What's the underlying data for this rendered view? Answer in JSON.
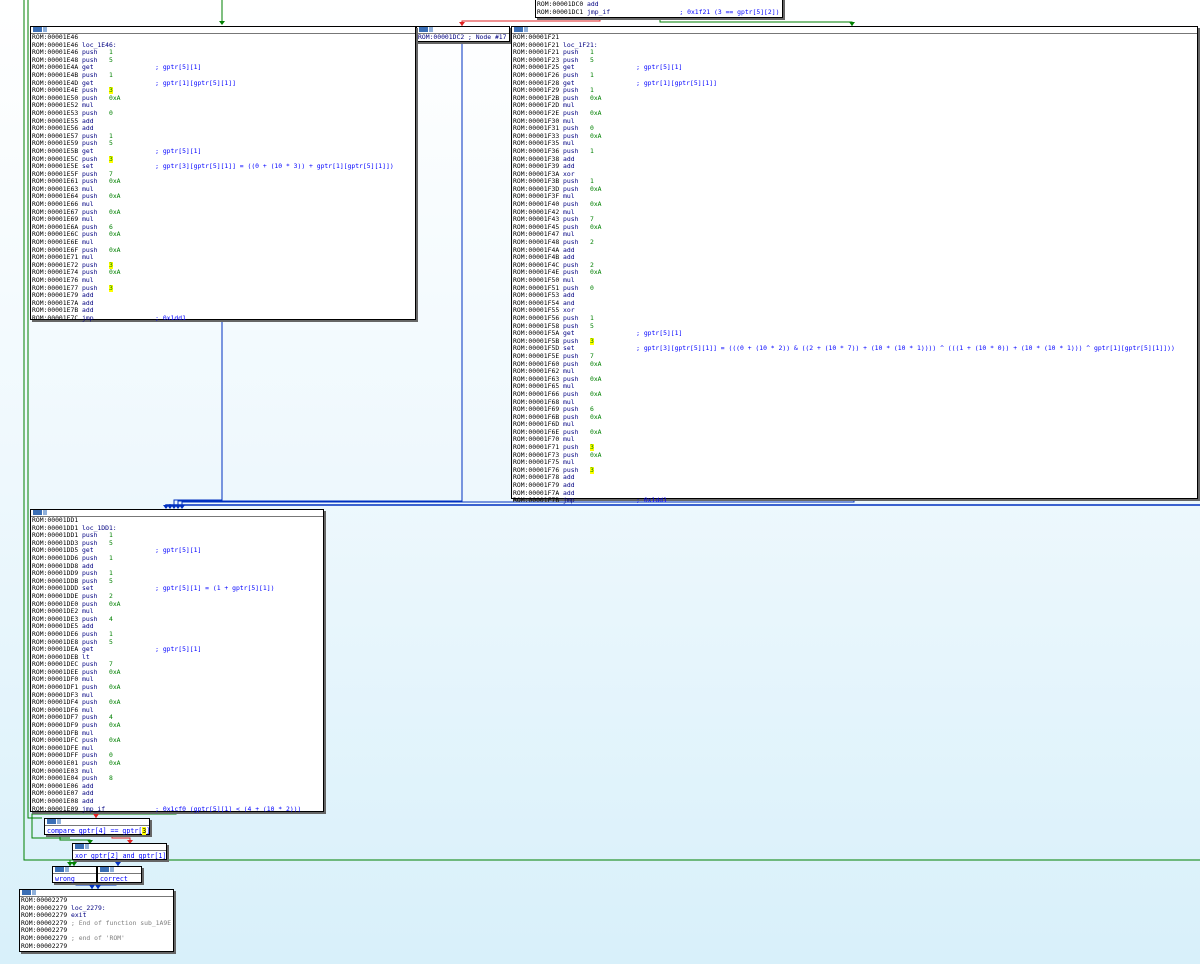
{
  "app": {
    "view": "IDA graph view"
  },
  "colors": {
    "edge_green": "#008000",
    "edge_red": "#e02020",
    "edge_blue": "#0030c0"
  },
  "top_node": {
    "lines": [
      {
        "addr": "ROM:00001DC0",
        "mnem": "add",
        "op": "",
        "cmt": ""
      },
      {
        "addr": "ROM:00001DC1",
        "mnem": "jmp_if",
        "op": "",
        "cmt": "; 0x1f21 (3 == gptr[5][2])"
      }
    ]
  },
  "node_17": {
    "text": "ROM:00001DC2 ; Node #17"
  },
  "node_1e46": {
    "lines": [
      {
        "addr": "ROM:00001E46",
        "mnem": "",
        "op": "",
        "cmt": ""
      },
      {
        "addr": "ROM:00001E46",
        "label": "loc_1E46:"
      },
      {
        "addr": "ROM:00001E46",
        "mnem": "push",
        "op": "1",
        "cmt": ""
      },
      {
        "addr": "ROM:00001E48",
        "mnem": "push",
        "op": "5",
        "cmt": ""
      },
      {
        "addr": "ROM:00001E4A",
        "mnem": "get",
        "op": "",
        "cmt": "; gptr[5][1]"
      },
      {
        "addr": "ROM:00001E4B",
        "mnem": "push",
        "op": "1",
        "cmt": ""
      },
      {
        "addr": "ROM:00001E4D",
        "mnem": "get",
        "op": "",
        "cmt": "; gptr[1][gptr[5][1]]"
      },
      {
        "addr": "ROM:00001E4E",
        "mnem": "push",
        "op": "3",
        "hl": true,
        "cmt": ""
      },
      {
        "addr": "ROM:00001E50",
        "mnem": "push",
        "op": "0xA",
        "cmt": ""
      },
      {
        "addr": "ROM:00001E52",
        "mnem": "mul",
        "op": "",
        "cmt": ""
      },
      {
        "addr": "ROM:00001E53",
        "mnem": "push",
        "op": "0",
        "cmt": ""
      },
      {
        "addr": "ROM:00001E55",
        "mnem": "add",
        "op": "",
        "cmt": ""
      },
      {
        "addr": "ROM:00001E56",
        "mnem": "add",
        "op": "",
        "cmt": ""
      },
      {
        "addr": "ROM:00001E57",
        "mnem": "push",
        "op": "1",
        "cmt": ""
      },
      {
        "addr": "ROM:00001E59",
        "mnem": "push",
        "op": "5",
        "cmt": ""
      },
      {
        "addr": "ROM:00001E5B",
        "mnem": "get",
        "op": "",
        "cmt": "; gptr[5][1]"
      },
      {
        "addr": "ROM:00001E5C",
        "mnem": "push",
        "op": "3",
        "hl": true,
        "cmt": ""
      },
      {
        "addr": "ROM:00001E5E",
        "mnem": "set",
        "op": "",
        "cmt": "; gptr[3][gptr[5][1]] = ((0 + (10 * 3)) + gptr[1][gptr[5][1]])"
      },
      {
        "addr": "ROM:00001E5F",
        "mnem": "push",
        "op": "7",
        "cmt": ""
      },
      {
        "addr": "ROM:00001E61",
        "mnem": "push",
        "op": "0xA",
        "cmt": ""
      },
      {
        "addr": "ROM:00001E63",
        "mnem": "mul",
        "op": "",
        "cmt": ""
      },
      {
        "addr": "ROM:00001E64",
        "mnem": "push",
        "op": "0xA",
        "cmt": ""
      },
      {
        "addr": "ROM:00001E66",
        "mnem": "mul",
        "op": "",
        "cmt": ""
      },
      {
        "addr": "ROM:00001E67",
        "mnem": "push",
        "op": "0xA",
        "cmt": ""
      },
      {
        "addr": "ROM:00001E69",
        "mnem": "mul",
        "op": "",
        "cmt": ""
      },
      {
        "addr": "ROM:00001E6A",
        "mnem": "push",
        "op": "6",
        "cmt": ""
      },
      {
        "addr": "ROM:00001E6C",
        "mnem": "push",
        "op": "0xA",
        "cmt": ""
      },
      {
        "addr": "ROM:00001E6E",
        "mnem": "mul",
        "op": "",
        "cmt": ""
      },
      {
        "addr": "ROM:00001E6F",
        "mnem": "push",
        "op": "0xA",
        "cmt": ""
      },
      {
        "addr": "ROM:00001E71",
        "mnem": "mul",
        "op": "",
        "cmt": ""
      },
      {
        "addr": "ROM:00001E72",
        "mnem": "push",
        "op": "3",
        "hl": true,
        "cmt": ""
      },
      {
        "addr": "ROM:00001E74",
        "mnem": "push",
        "op": "0xA",
        "cmt": ""
      },
      {
        "addr": "ROM:00001E76",
        "mnem": "mul",
        "op": "",
        "cmt": ""
      },
      {
        "addr": "ROM:00001E77",
        "mnem": "push",
        "op": "3",
        "hl": true,
        "cmt": ""
      },
      {
        "addr": "ROM:00001E79",
        "mnem": "add",
        "op": "",
        "cmt": ""
      },
      {
        "addr": "ROM:00001E7A",
        "mnem": "add",
        "op": "",
        "cmt": ""
      },
      {
        "addr": "ROM:00001E7B",
        "mnem": "add",
        "op": "",
        "cmt": ""
      },
      {
        "addr": "ROM:00001E7C",
        "mnem": "jmp",
        "op": "",
        "cmt": "; 0x1dd1"
      }
    ]
  },
  "node_1f21": {
    "lines": [
      {
        "addr": "ROM:00001F21",
        "mnem": "",
        "op": "",
        "cmt": ""
      },
      {
        "addr": "ROM:00001F21",
        "label": "loc_1F21:"
      },
      {
        "addr": "ROM:00001F21",
        "mnem": "push",
        "op": "1",
        "cmt": ""
      },
      {
        "addr": "ROM:00001F23",
        "mnem": "push",
        "op": "5",
        "cmt": ""
      },
      {
        "addr": "ROM:00001F25",
        "mnem": "get",
        "op": "",
        "cmt": "; gptr[5][1]"
      },
      {
        "addr": "ROM:00001F26",
        "mnem": "push",
        "op": "1",
        "cmt": ""
      },
      {
        "addr": "ROM:00001F28",
        "mnem": "get",
        "op": "",
        "cmt": "; gptr[1][gptr[5][1]]"
      },
      {
        "addr": "ROM:00001F29",
        "mnem": "push",
        "op": "1",
        "cmt": ""
      },
      {
        "addr": "ROM:00001F2B",
        "mnem": "push",
        "op": "0xA",
        "cmt": ""
      },
      {
        "addr": "ROM:00001F2D",
        "mnem": "mul",
        "op": "",
        "cmt": ""
      },
      {
        "addr": "ROM:00001F2E",
        "mnem": "push",
        "op": "0xA",
        "cmt": ""
      },
      {
        "addr": "ROM:00001F30",
        "mnem": "mul",
        "op": "",
        "cmt": ""
      },
      {
        "addr": "ROM:00001F31",
        "mnem": "push",
        "op": "0",
        "cmt": ""
      },
      {
        "addr": "ROM:00001F33",
        "mnem": "push",
        "op": "0xA",
        "cmt": ""
      },
      {
        "addr": "ROM:00001F35",
        "mnem": "mul",
        "op": "",
        "cmt": ""
      },
      {
        "addr": "ROM:00001F36",
        "mnem": "push",
        "op": "1",
        "cmt": ""
      },
      {
        "addr": "ROM:00001F38",
        "mnem": "add",
        "op": "",
        "cmt": ""
      },
      {
        "addr": "ROM:00001F39",
        "mnem": "add",
        "op": "",
        "cmt": ""
      },
      {
        "addr": "ROM:00001F3A",
        "mnem": "xor",
        "op": "",
        "cmt": ""
      },
      {
        "addr": "ROM:00001F3B",
        "mnem": "push",
        "op": "1",
        "cmt": ""
      },
      {
        "addr": "ROM:00001F3D",
        "mnem": "push",
        "op": "0xA",
        "cmt": ""
      },
      {
        "addr": "ROM:00001F3F",
        "mnem": "mul",
        "op": "",
        "cmt": ""
      },
      {
        "addr": "ROM:00001F40",
        "mnem": "push",
        "op": "0xA",
        "cmt": ""
      },
      {
        "addr": "ROM:00001F42",
        "mnem": "mul",
        "op": "",
        "cmt": ""
      },
      {
        "addr": "ROM:00001F43",
        "mnem": "push",
        "op": "7",
        "cmt": ""
      },
      {
        "addr": "ROM:00001F45",
        "mnem": "push",
        "op": "0xA",
        "cmt": ""
      },
      {
        "addr": "ROM:00001F47",
        "mnem": "mul",
        "op": "",
        "cmt": ""
      },
      {
        "addr": "ROM:00001F48",
        "mnem": "push",
        "op": "2",
        "cmt": ""
      },
      {
        "addr": "ROM:00001F4A",
        "mnem": "add",
        "op": "",
        "cmt": ""
      },
      {
        "addr": "ROM:00001F4B",
        "mnem": "add",
        "op": "",
        "cmt": ""
      },
      {
        "addr": "ROM:00001F4C",
        "mnem": "push",
        "op": "2",
        "cmt": ""
      },
      {
        "addr": "ROM:00001F4E",
        "mnem": "push",
        "op": "0xA",
        "cmt": ""
      },
      {
        "addr": "ROM:00001F50",
        "mnem": "mul",
        "op": "",
        "cmt": ""
      },
      {
        "addr": "ROM:00001F51",
        "mnem": "push",
        "op": "0",
        "cmt": ""
      },
      {
        "addr": "ROM:00001F53",
        "mnem": "add",
        "op": "",
        "cmt": ""
      },
      {
        "addr": "ROM:00001F54",
        "mnem": "and",
        "op": "",
        "cmt": ""
      },
      {
        "addr": "ROM:00001F55",
        "mnem": "xor",
        "op": "",
        "cmt": ""
      },
      {
        "addr": "ROM:00001F56",
        "mnem": "push",
        "op": "1",
        "cmt": ""
      },
      {
        "addr": "ROM:00001F58",
        "mnem": "push",
        "op": "5",
        "cmt": ""
      },
      {
        "addr": "ROM:00001F5A",
        "mnem": "get",
        "op": "",
        "cmt": "; gptr[5][1]"
      },
      {
        "addr": "ROM:00001F5B",
        "mnem": "push",
        "op": "3",
        "hl": true,
        "cmt": ""
      },
      {
        "addr": "ROM:00001F5D",
        "mnem": "set",
        "op": "",
        "cmt": "; gptr[3][gptr[5][1]] = (((0 + (10 * 2)) & ((2 + (10 * 7)) + (10 * (10 * 1)))) ^ (((1 + (10 * 0)) + (10 * (10 * 1))) ^ gptr[1][gptr[5][1]]))"
      },
      {
        "addr": "ROM:00001F5E",
        "mnem": "push",
        "op": "7",
        "cmt": ""
      },
      {
        "addr": "ROM:00001F60",
        "mnem": "push",
        "op": "0xA",
        "cmt": ""
      },
      {
        "addr": "ROM:00001F62",
        "mnem": "mul",
        "op": "",
        "cmt": ""
      },
      {
        "addr": "ROM:00001F63",
        "mnem": "push",
        "op": "0xA",
        "cmt": ""
      },
      {
        "addr": "ROM:00001F65",
        "mnem": "mul",
        "op": "",
        "cmt": ""
      },
      {
        "addr": "ROM:00001F66",
        "mnem": "push",
        "op": "0xA",
        "cmt": ""
      },
      {
        "addr": "ROM:00001F68",
        "mnem": "mul",
        "op": "",
        "cmt": ""
      },
      {
        "addr": "ROM:00001F69",
        "mnem": "push",
        "op": "6",
        "cmt": ""
      },
      {
        "addr": "ROM:00001F6B",
        "mnem": "push",
        "op": "0xA",
        "cmt": ""
      },
      {
        "addr": "ROM:00001F6D",
        "mnem": "mul",
        "op": "",
        "cmt": ""
      },
      {
        "addr": "ROM:00001F6E",
        "mnem": "push",
        "op": "0xA",
        "cmt": ""
      },
      {
        "addr": "ROM:00001F70",
        "mnem": "mul",
        "op": "",
        "cmt": ""
      },
      {
        "addr": "ROM:00001F71",
        "mnem": "push",
        "op": "3",
        "hl": true,
        "cmt": ""
      },
      {
        "addr": "ROM:00001F73",
        "mnem": "push",
        "op": "0xA",
        "cmt": ""
      },
      {
        "addr": "ROM:00001F75",
        "mnem": "mul",
        "op": "",
        "cmt": ""
      },
      {
        "addr": "ROM:00001F76",
        "mnem": "push",
        "op": "3",
        "hl": true,
        "cmt": ""
      },
      {
        "addr": "ROM:00001F78",
        "mnem": "add",
        "op": "",
        "cmt": ""
      },
      {
        "addr": "ROM:00001F79",
        "mnem": "add",
        "op": "",
        "cmt": ""
      },
      {
        "addr": "ROM:00001F7A",
        "mnem": "add",
        "op": "",
        "cmt": ""
      },
      {
        "addr": "ROM:00001F7B",
        "mnem": "jmp",
        "op": "",
        "cmt": "; 0x1dd1"
      }
    ]
  },
  "node_1dd1": {
    "lines": [
      {
        "addr": "ROM:00001DD1",
        "mnem": "",
        "op": "",
        "cmt": ""
      },
      {
        "addr": "ROM:00001DD1",
        "label": "loc_1DD1:"
      },
      {
        "addr": "ROM:00001DD1",
        "mnem": "push",
        "op": "1",
        "cmt": ""
      },
      {
        "addr": "ROM:00001DD3",
        "mnem": "push",
        "op": "5",
        "cmt": ""
      },
      {
        "addr": "ROM:00001DD5",
        "mnem": "get",
        "op": "",
        "cmt": "; gptr[5][1]"
      },
      {
        "addr": "ROM:00001DD6",
        "mnem": "push",
        "op": "1",
        "cmt": ""
      },
      {
        "addr": "ROM:00001DD8",
        "mnem": "add",
        "op": "",
        "cmt": ""
      },
      {
        "addr": "ROM:00001DD9",
        "mnem": "push",
        "op": "1",
        "cmt": ""
      },
      {
        "addr": "ROM:00001DDB",
        "mnem": "push",
        "op": "5",
        "cmt": ""
      },
      {
        "addr": "ROM:00001DDD",
        "mnem": "set",
        "op": "",
        "cmt": "; gptr[5][1] = (1 + gptr[5][1])"
      },
      {
        "addr": "ROM:00001DDE",
        "mnem": "push",
        "op": "2",
        "cmt": ""
      },
      {
        "addr": "ROM:00001DE0",
        "mnem": "push",
        "op": "0xA",
        "cmt": ""
      },
      {
        "addr": "ROM:00001DE2",
        "mnem": "mul",
        "op": "",
        "cmt": ""
      },
      {
        "addr": "ROM:00001DE3",
        "mnem": "push",
        "op": "4",
        "cmt": ""
      },
      {
        "addr": "ROM:00001DE5",
        "mnem": "add",
        "op": "",
        "cmt": ""
      },
      {
        "addr": "ROM:00001DE6",
        "mnem": "push",
        "op": "1",
        "cmt": ""
      },
      {
        "addr": "ROM:00001DE8",
        "mnem": "push",
        "op": "5",
        "cmt": ""
      },
      {
        "addr": "ROM:00001DEA",
        "mnem": "get",
        "op": "",
        "cmt": "; gptr[5][1]"
      },
      {
        "addr": "ROM:00001DEB",
        "mnem": "lt",
        "op": "",
        "cmt": ""
      },
      {
        "addr": "ROM:00001DEC",
        "mnem": "push",
        "op": "7",
        "cmt": ""
      },
      {
        "addr": "ROM:00001DEE",
        "mnem": "push",
        "op": "0xA",
        "cmt": ""
      },
      {
        "addr": "ROM:00001DF0",
        "mnem": "mul",
        "op": "",
        "cmt": ""
      },
      {
        "addr": "ROM:00001DF1",
        "mnem": "push",
        "op": "0xA",
        "cmt": ""
      },
      {
        "addr": "ROM:00001DF3",
        "mnem": "mul",
        "op": "",
        "cmt": ""
      },
      {
        "addr": "ROM:00001DF4",
        "mnem": "push",
        "op": "0xA",
        "cmt": ""
      },
      {
        "addr": "ROM:00001DF6",
        "mnem": "mul",
        "op": "",
        "cmt": ""
      },
      {
        "addr": "ROM:00001DF7",
        "mnem": "push",
        "op": "4",
        "cmt": ""
      },
      {
        "addr": "ROM:00001DF9",
        "mnem": "push",
        "op": "0xA",
        "cmt": ""
      },
      {
        "addr": "ROM:00001DFB",
        "mnem": "mul",
        "op": "",
        "cmt": ""
      },
      {
        "addr": "ROM:00001DFC",
        "mnem": "push",
        "op": "0xA",
        "cmt": ""
      },
      {
        "addr": "ROM:00001DFE",
        "mnem": "mul",
        "op": "",
        "cmt": ""
      },
      {
        "addr": "ROM:00001DFF",
        "mnem": "push",
        "op": "0",
        "cmt": ""
      },
      {
        "addr": "ROM:00001E01",
        "mnem": "push",
        "op": "0xA",
        "cmt": ""
      },
      {
        "addr": "ROM:00001E03",
        "mnem": "mul",
        "op": "",
        "cmt": ""
      },
      {
        "addr": "ROM:00001E04",
        "mnem": "push",
        "op": "8",
        "cmt": ""
      },
      {
        "addr": "ROM:00001E06",
        "mnem": "add",
        "op": "",
        "cmt": ""
      },
      {
        "addr": "ROM:00001E07",
        "mnem": "add",
        "op": "",
        "cmt": ""
      },
      {
        "addr": "ROM:00001E08",
        "mnem": "add",
        "op": "",
        "cmt": ""
      },
      {
        "addr": "ROM:00001E09",
        "mnem": "jmp_if",
        "op": "",
        "cmt": "; 0x1cf0 (gptr[5][1] < (4 + (10 * 2)))"
      }
    ]
  },
  "compare_node": {
    "pre": "compare gptr[4] == gptr[",
    "hl": "3",
    "post": "]"
  },
  "xor_node": {
    "text": "xor gptr[2] and gptr[1]"
  },
  "wrong_node": {
    "text": "wrong"
  },
  "correct_node": {
    "text": "correct"
  },
  "exit_node": {
    "lines": [
      {
        "addr": "ROM:00002279",
        "mnem": "",
        "op": "",
        "cmt": ""
      },
      {
        "addr": "ROM:00002279",
        "label": "loc_2279:"
      },
      {
        "addr": "ROM:00002279",
        "mnem": "exit",
        "op": "",
        "cmt": ""
      },
      {
        "addr": "ROM:00002279",
        "gray": "; End of function sub_1A9E"
      },
      {
        "addr": "ROM:00002279",
        "mnem": "",
        "op": "",
        "cmt": ""
      },
      {
        "addr": "ROM:00002279",
        "gray": "; end of 'ROM'"
      },
      {
        "addr": "ROM:00002279",
        "mnem": "",
        "op": "",
        "cmt": ""
      }
    ]
  }
}
